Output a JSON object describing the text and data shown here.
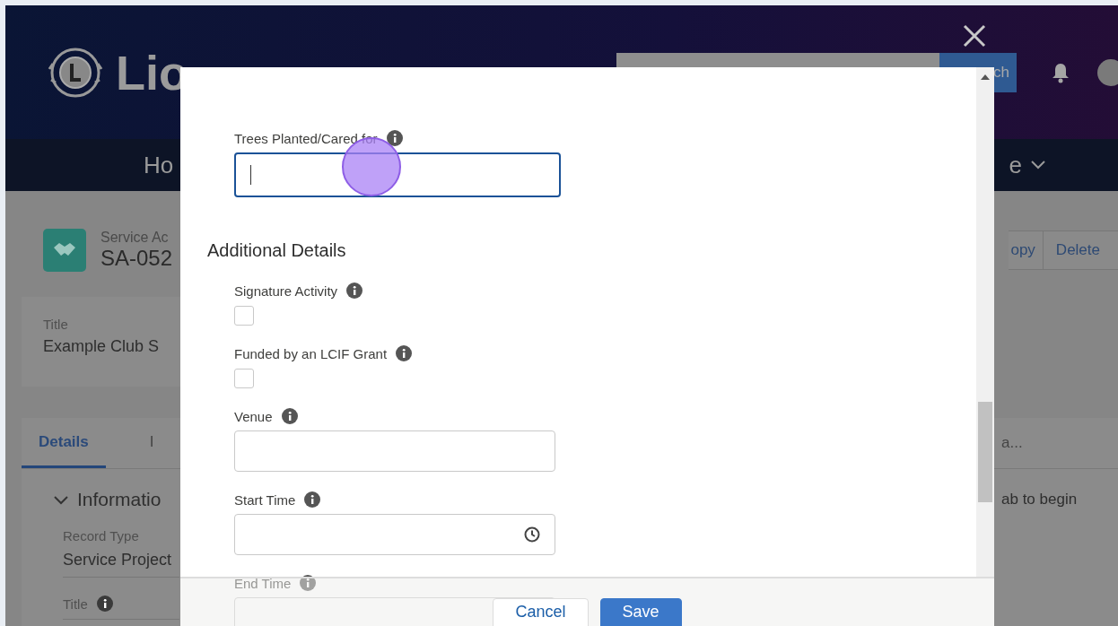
{
  "header": {
    "title": "Lio",
    "search_button": "ch",
    "nav_left": "Ho",
    "nav_right": "e"
  },
  "record": {
    "object_label": "Service Ac",
    "record_name": "SA-052",
    "actions": [
      "opy",
      "Delete"
    ]
  },
  "highlights": {
    "label": "Title",
    "value": "Example Club S"
  },
  "tabs": [
    {
      "label": "Details",
      "selected": true
    },
    {
      "label": "I",
      "selected": false
    }
  ],
  "tabs_overflow": "a...",
  "section": {
    "title": "Informatio",
    "expanded": true,
    "hint": "ab to begin",
    "fields": [
      {
        "label": "Record Type",
        "value": "Service Project",
        "info": false
      },
      {
        "label": "Title",
        "info": true
      }
    ]
  },
  "modal": {
    "fields": [
      {
        "label": "Trees Planted/Cared for",
        "kind": "text",
        "focused": true
      }
    ],
    "section_title": "Additional Details",
    "section_fields": [
      {
        "label": "Signature Activity",
        "kind": "checkbox",
        "checked": false
      },
      {
        "label": "Funded by an LCIF Grant",
        "kind": "checkbox",
        "checked": false
      },
      {
        "label": "Venue",
        "kind": "text",
        "focused": false
      },
      {
        "label": "Start Time",
        "kind": "time",
        "focused": false
      },
      {
        "label": "End Time",
        "kind": "time",
        "focused": false
      }
    ],
    "buttons": [
      {
        "label": "Cancel",
        "kind": "neutral"
      },
      {
        "label": "Save",
        "kind": "brand"
      }
    ]
  }
}
